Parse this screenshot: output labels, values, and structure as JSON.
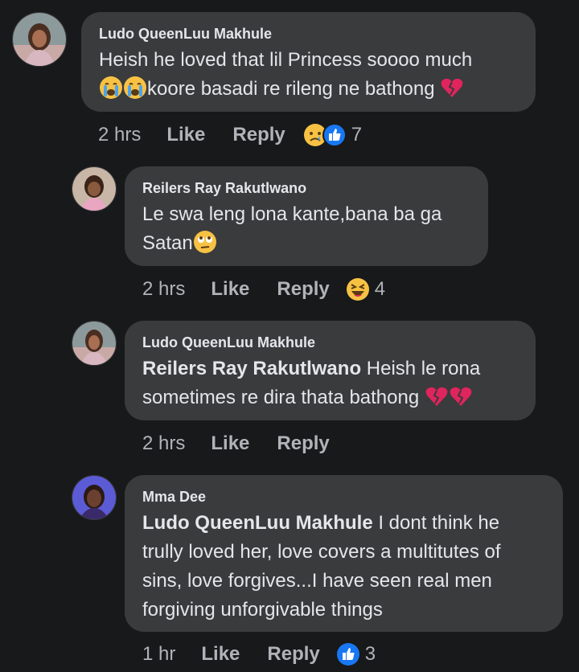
{
  "comments": [
    {
      "author": "Ludo QueenLuu Makhule",
      "line1": "Heish he loved that lil Princess soooo much",
      "line2": "koore basadi re rileng ne bathong",
      "time": "2 hrs",
      "like": "Like",
      "reply": "Reply",
      "reaction_count": "7"
    },
    {
      "author": "Reilers Ray Rakutlwano",
      "line1": "Le swa leng lona kante,bana ba ga",
      "line2": "Satan",
      "time": "2 hrs",
      "like": "Like",
      "reply": "Reply",
      "reaction_count": "4"
    },
    {
      "author": "Ludo QueenLuu Makhule",
      "mention": "Reilers Ray Rakutlwano",
      "line1": " Heish le rona",
      "line2": "sometimes re dira thata bathong",
      "time": "2 hrs",
      "like": "Like",
      "reply": "Reply"
    },
    {
      "author": "Mma Dee",
      "mention": "Ludo QueenLuu Makhule",
      "line1": " I dont think he",
      "line2": "trully loved her, love covers a multitutes of",
      "line3": "sins, love forgives...I have seen real men",
      "line4": "forgiving unforgivable things",
      "time": "1 hr",
      "like": "Like",
      "reply": "Reply",
      "reaction_count": "3"
    }
  ],
  "colors": {
    "background": "#18191a",
    "bubble": "#3a3b3c",
    "text": "#e4e6eb",
    "secondary_text": "#b0b3b8",
    "like_blue": "#1877f2",
    "emoji_yellow": "#f7c244",
    "heart_red": "#e0245e"
  },
  "icons": [
    "crying-face-icon",
    "broken-heart-icon",
    "sad-face-reaction-icon",
    "like-reaction-icon",
    "haha-reaction-icon",
    "rolling-eyes-icon"
  ]
}
